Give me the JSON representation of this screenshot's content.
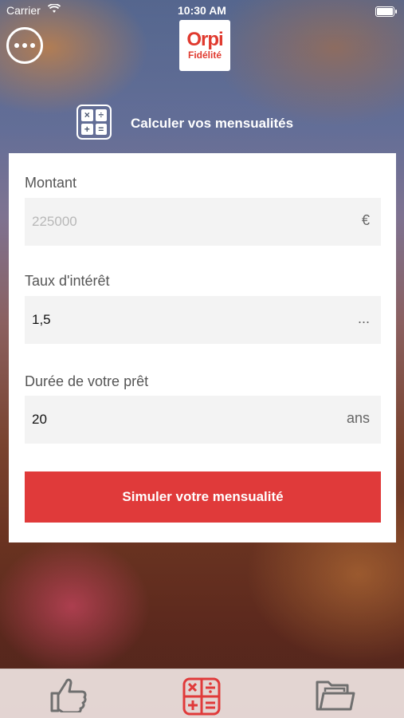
{
  "status_bar": {
    "carrier": "Carrier",
    "time": "10:30 AM"
  },
  "logo": {
    "brand": "Orpi",
    "tagline": "Fidélité"
  },
  "header": {
    "title": "Calculer vos mensualités",
    "icon": "calculator-icon"
  },
  "form": {
    "amount": {
      "label": "Montant",
      "placeholder": "225000",
      "suffix": "€"
    },
    "rate": {
      "label": "Taux d'intérêt",
      "value": "1,5",
      "suffix": "..."
    },
    "duration": {
      "label": "Durée de votre prêt",
      "value": "20",
      "suffix": "ans"
    }
  },
  "actions": {
    "simulate_label": "Simuler votre mensualité"
  },
  "tab_bar": {
    "tabs": [
      {
        "icon": "thumbs-up-icon"
      },
      {
        "icon": "calculator-icon",
        "selected": true
      },
      {
        "icon": "folder-icon"
      }
    ]
  },
  "colors": {
    "accent": "#e03a3a",
    "brand": "#e03a2f",
    "field_bg": "#f3f3f3"
  }
}
